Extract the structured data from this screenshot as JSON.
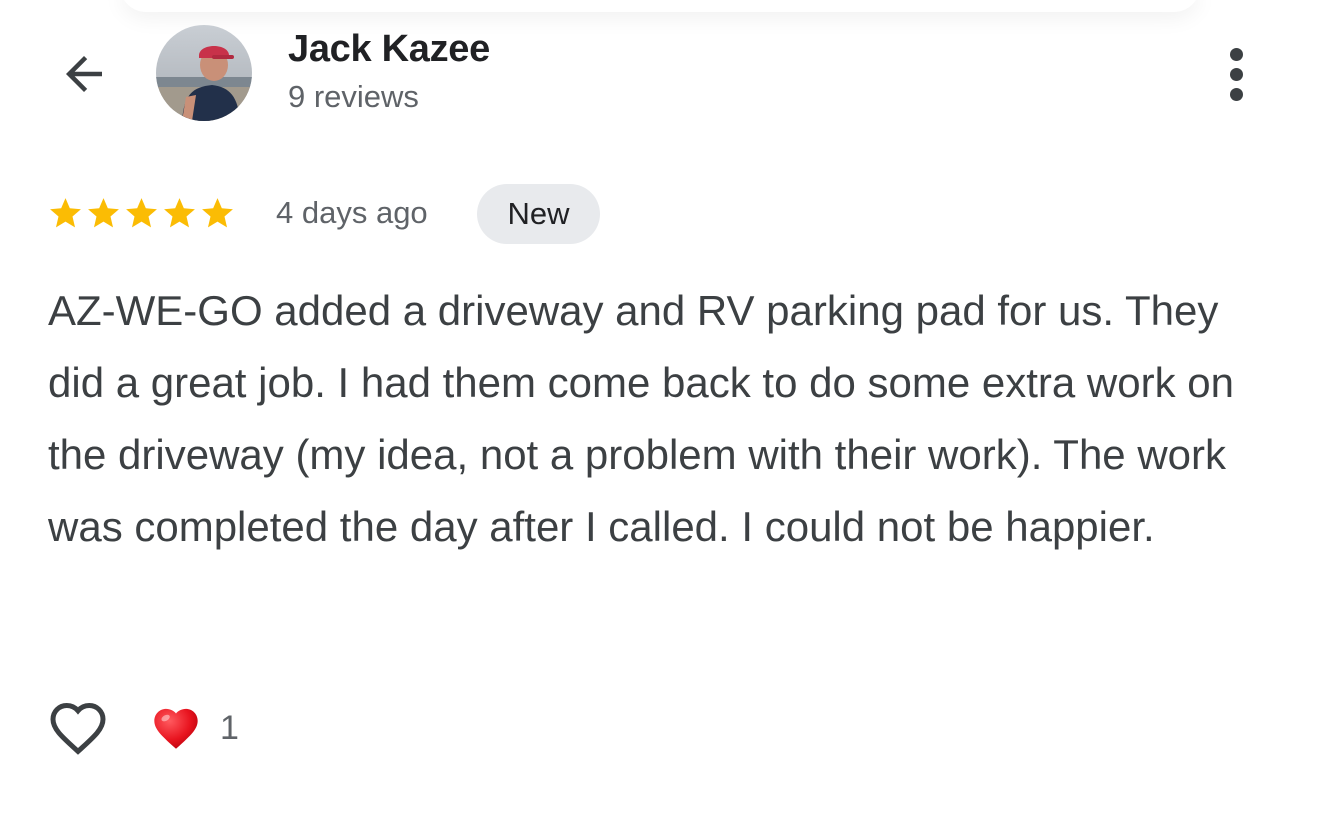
{
  "header": {
    "back_icon": "arrow-left-icon",
    "avatar_icon": "profile-photo",
    "reviewer_name": "Jack Kazee",
    "review_count": "9 reviews",
    "more_icon": "more-vert-icon"
  },
  "review": {
    "rating": 5,
    "rating_max": 5,
    "star_color": "#fbbc04",
    "time_ago": "4 days ago",
    "badge": "New",
    "text": "AZ-WE-GO added a driveway and RV parking pad for us. They did a great job. I had them come back to do some extra work on the driveway (my idea, not a problem with their work). The work was completed the day after I called. I could not be happier."
  },
  "reactions": {
    "like_icon": "heart-outline-icon",
    "reaction_icon": "red-heart-icon",
    "count": "1"
  }
}
